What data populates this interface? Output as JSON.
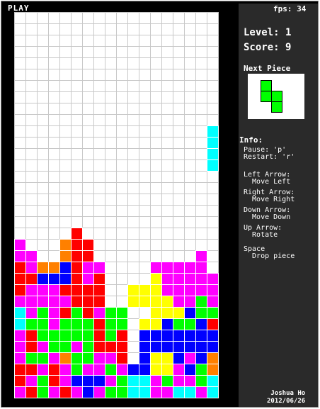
{
  "window": {
    "label": "PLAY"
  },
  "stats": {
    "fps": "fps: 34",
    "level": "Level: 1",
    "score": "Score: 9"
  },
  "next_piece": {
    "title": "Next Piece",
    "cells": [
      [
        0,
        0
      ],
      [
        0,
        1
      ],
      [
        1,
        1
      ],
      [
        1,
        2
      ]
    ],
    "color": "#00ff00"
  },
  "info": {
    "title": "Info:",
    "pause": "Pause: 'p'",
    "restart": "Restart: 'r'",
    "left_label": "Left Arrow:",
    "left_action": "  Move Left",
    "right_label": "Right Arrow:",
    "right_action": "  Move Right",
    "down_label": "Down Arrow:",
    "down_action": "  Move Down",
    "up_label": "Up Arrow:",
    "up_action": "  Rotate",
    "space_label": "Space",
    "space_action": "  Drop piece"
  },
  "author": {
    "name": "Joshua Ho",
    "date": "2012/06/26"
  },
  "colors": {
    "frame": "#000000",
    "board_bg": "#ffffff",
    "grid": "#c8c8c8",
    "sidebar": "#2a2a2a",
    "text": "#ffffff"
  },
  "board": {
    "cols": 18,
    "rows": 34,
    "legend": {
      "M": "#ff00ff",
      "R": "#ff0000",
      "O": "#ff8000",
      "B": "#0000ff",
      "G": "#00ff00",
      "C": "#00ffff",
      "Y": "#ffff00"
    },
    "falling_piece": {
      "color": "#00ffff",
      "cells": [
        [
          17,
          10
        ],
        [
          17,
          11
        ],
        [
          17,
          12
        ],
        [
          17,
          13
        ]
      ]
    },
    "stack_rows": [
      "..................",
      "..................",
      "..................",
      "..................",
      "..................",
      "..................",
      "..................",
      "..................",
      "..................",
      "..................",
      "..................",
      "..................",
      "..................",
      "..................",
      "..................",
      "..................",
      "..................",
      "..................",
      "..................",
      ".....R............",
      "M...ORR...........",
      "MM..ORR.........M.",
      "RMOOBRMM....MMMMM.",
      "RRBBBRMR....YMMMMM",
      "RMMMRRRR..YYYMMMMM",
      "MMMMMRRR..YYYYMMGM",
      "CMGMRGRMGG..YYYBGGO",
      "CGGMGGGRGG.YYBGGBRO",
      "MRGGGGGRGR.BBBBBBBO",
      "MRMGGMGRRR.BBBBBBBO",
      "MGGMOGGMMR.BYYBMBO.",
      "RRMRMGMMGMBBYYMBGO.",
      "RMGRMBBBMGCCMGMMGCC",
      "MRGMRMBMGGCCMMCCMCC"
    ]
  }
}
